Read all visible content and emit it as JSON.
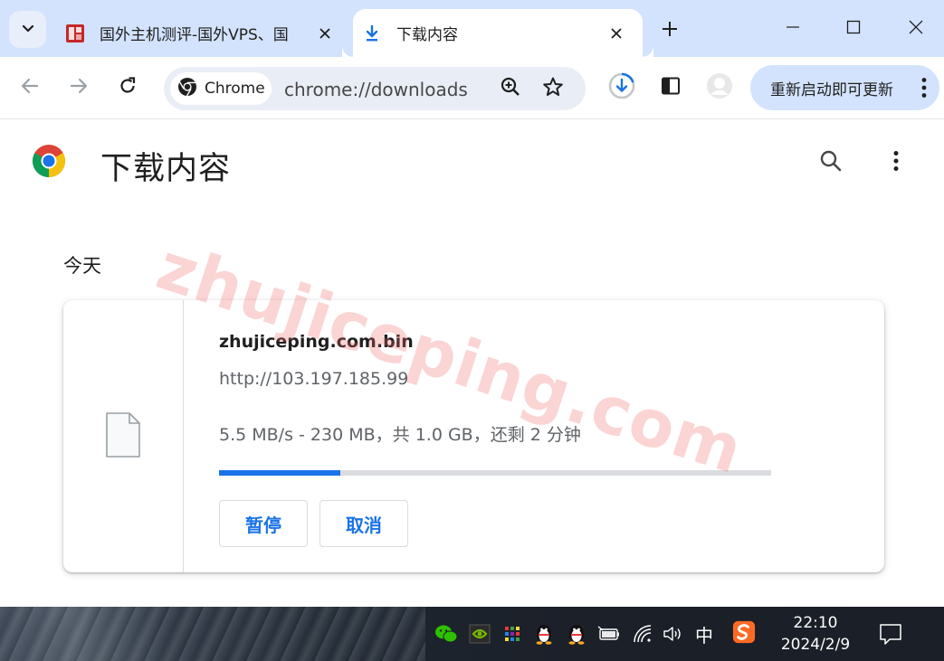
{
  "browser": {
    "tabs": [
      {
        "title": "国外主机测评-国外VPS、国",
        "active": false
      },
      {
        "title": "下载内容",
        "active": true
      }
    ],
    "omnibox": {
      "chip_label": "Chrome",
      "url": "chrome://downloads"
    },
    "update_button_label": "重新启动即可更新"
  },
  "page": {
    "title": "下载内容",
    "section_date": "今天"
  },
  "download": {
    "file_name": "zhujiceping.com.bin",
    "url": "http://103.197.185.99",
    "status": "5.5 MB/s - 230 MB，共 1.0 GB，还剩 2 分钟",
    "progress_fraction": 0.22,
    "pause_label": "暂停",
    "cancel_label": "取消"
  },
  "watermark": "zhujiceping.com",
  "taskbar": {
    "ime": "中",
    "time": "22:10",
    "date": "2024/2/9"
  },
  "colors": {
    "accent": "#1a73e8",
    "tabstrip": "#d3e3fd",
    "omnibox": "#e9eef6"
  }
}
